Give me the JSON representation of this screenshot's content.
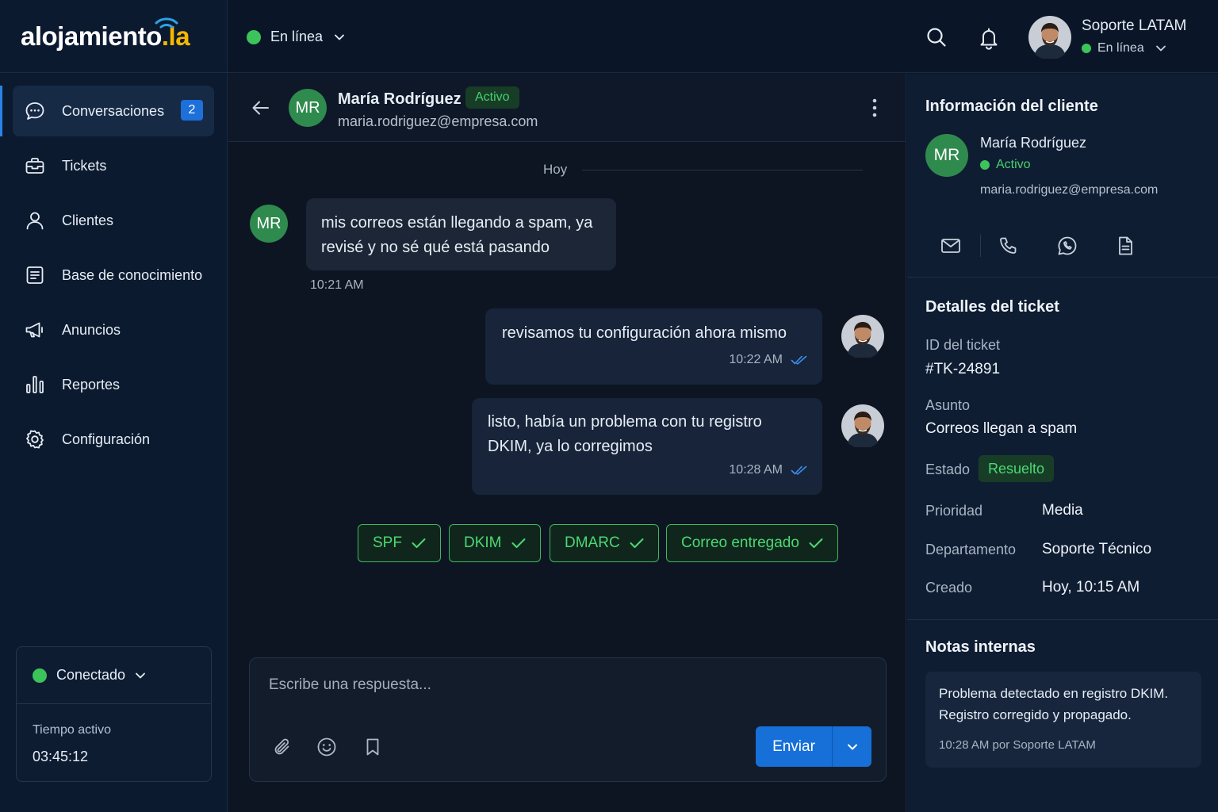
{
  "brand": {
    "name": "alojamiento",
    "tld": ".la",
    "accent": "#f5b800",
    "wifi_color": "#2aa3ea"
  },
  "sidebar": {
    "items": [
      {
        "label": "Conversaciones",
        "icon": "chat-bubble-icon",
        "badge": "2",
        "active": true
      },
      {
        "label": "Tickets",
        "icon": "ticket-icon"
      },
      {
        "label": "Clientes",
        "icon": "user-icon"
      },
      {
        "label": "Base de conocimiento",
        "icon": "document-icon"
      },
      {
        "label": "Anuncios",
        "icon": "megaphone-icon"
      },
      {
        "label": "Reportes",
        "icon": "bar-chart-icon"
      },
      {
        "label": "Configuración",
        "icon": "gear-icon"
      }
    ],
    "connection": {
      "label": "Conectado",
      "uptime_label": "Tiempo activo",
      "uptime": "03:45:12"
    }
  },
  "topbar": {
    "status": "En línea",
    "user": {
      "name": "Soporte LATAM",
      "status": "En línea"
    }
  },
  "chat": {
    "contact": {
      "initials": "MR",
      "name": "María Rodríguez",
      "badge": "Activo",
      "email": "maria.rodriguez@empresa.com"
    },
    "day": "Hoy",
    "messages": [
      {
        "from": "customer",
        "text": "mis correos están llegando a spam, ya revisé y no sé qué está pasando",
        "time": "10:21 AM"
      },
      {
        "from": "agent",
        "text": "revisamos tu configuración ahora mismo",
        "time": "10:22 AM"
      },
      {
        "from": "agent",
        "text": "listo, había un problema con tu registro DKIM, ya lo corregimos",
        "time": "10:28 AM"
      }
    ],
    "chips": [
      "SPF",
      "DKIM",
      "DMARC",
      "Correo entregado"
    ],
    "composer": {
      "placeholder": "Escribe una respuesta...",
      "send_label": "Enviar"
    }
  },
  "info": {
    "title": "Información del cliente",
    "customer": {
      "initials": "MR",
      "name": "María Rodríguez",
      "status": "Activo",
      "email": "maria.rodriguez@empresa.com"
    },
    "ticket": {
      "title": "Detalles del ticket",
      "id_label": "ID del ticket",
      "id": "#TK-24891",
      "subject_label": "Asunto",
      "subject": "Correos llegan a spam",
      "status_label": "Estado",
      "status": "Resuelto",
      "priority_label": "Prioridad",
      "priority": "Media",
      "department_label": "Departamento",
      "department": "Soporte Técnico",
      "created_label": "Creado",
      "created": "Hoy, 10:15 AM"
    },
    "notes": {
      "title": "Notas internas",
      "text": "Problema detectado en registro DKIM. Registro corregido y propagado.",
      "meta": "10:28 AM por Soporte LATAM"
    }
  },
  "colors": {
    "online": "#3cc35a",
    "primary": "#1670d8",
    "success_text": "#4cd873"
  }
}
